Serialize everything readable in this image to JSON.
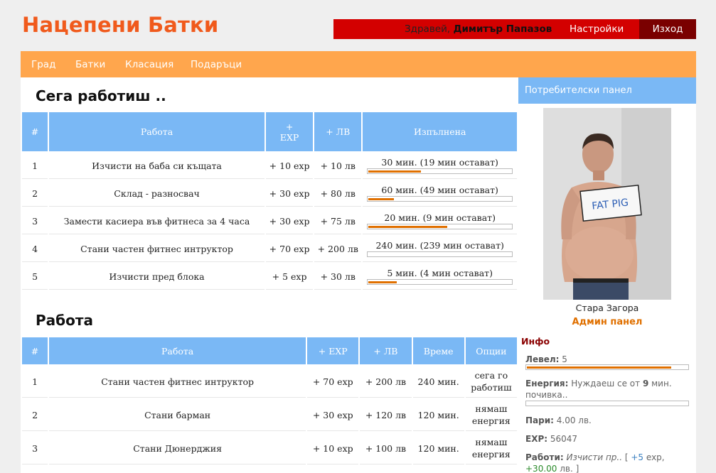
{
  "header": {
    "logo": "Нацепени Батки",
    "greeting": "Здравей, ",
    "username": "Димитър Папазов",
    "settings": "Настройки",
    "logout": "Изход"
  },
  "nav": [
    "Град",
    "Батки",
    "Класация",
    "Подаръци"
  ],
  "current": {
    "title": "Сега работиш ..",
    "headers": [
      "#",
      "Работа",
      "+ EXP",
      "+ ЛВ",
      "Изпълнена"
    ],
    "rows": [
      {
        "n": "1",
        "job": "Изчисти на баба си къщата",
        "exp": "+ 10 exp",
        "lv": "+ 10 лв",
        "status": "30 мин. (19 мин остават)",
        "progress": 0.37
      },
      {
        "n": "2",
        "job": "Склад - разносвач",
        "exp": "+ 30 exp",
        "lv": "+ 80 лв",
        "status": "60 мин. (49 мин остават)",
        "progress": 0.18
      },
      {
        "n": "3",
        "job": "Замести касиера във фитнеса за 4 часа",
        "exp": "+ 30 exp",
        "lv": "+ 75 лв",
        "status": "20 мин. (9 мин остават)",
        "progress": 0.55
      },
      {
        "n": "4",
        "job": "Стани частен фитнес интруктор",
        "exp": "+ 70 exp",
        "lv": "+ 200 лв",
        "status": "240 мин. (239 мин остават)",
        "progress": 0.0
      },
      {
        "n": "5",
        "job": "Изчисти пред блока",
        "exp": "+ 5 exp",
        "lv": "+ 30 лв",
        "status": "5 мин. (4 мин остават)",
        "progress": 0.2
      }
    ]
  },
  "work": {
    "title": "Работа",
    "headers": [
      "#",
      "Работа",
      "+ EXP",
      "+ ЛВ",
      "Време",
      "Опции"
    ],
    "rows": [
      {
        "n": "1",
        "job": "Стани частен фитнес интруктор",
        "exp": "+ 70 exp",
        "lv": "+ 200 лв",
        "time": "240 мин.",
        "option": "сега го работиш"
      },
      {
        "n": "2",
        "job": "Стани барман",
        "exp": "+ 30 exp",
        "lv": "+ 120 лв",
        "time": "120 мин.",
        "option": "нямаш енергия"
      },
      {
        "n": "3",
        "job": "Стани Дюнерджия",
        "exp": "+ 10 exp",
        "lv": "+ 100 лв",
        "time": "120 мин.",
        "option": "нямаш енергия"
      }
    ]
  },
  "sidebar": {
    "title": "Потребителски панел",
    "photo_sign": "FAT PIG",
    "city": "Стара Загора",
    "admin": "Админ панел",
    "info_title": "Инфо",
    "level_label": "Левел:",
    "level_value": "5",
    "level_progress": 0.9,
    "energy_label": "Енергия:",
    "energy_text_a": "Нуждаеш се от ",
    "energy_minutes": "9",
    "energy_text_b": " мин. почивка..",
    "energy_progress": 0.0,
    "money_label": "Пари:",
    "money_value": "4.00 лв.",
    "exp_label": "EXP:",
    "exp_value": "56047",
    "jobs_label": "Работи:",
    "jobs_job": "Изчисти пр..",
    "jobs_open": " [ ",
    "jobs_exp": "+5",
    "jobs_exp_unit": " exp, ",
    "jobs_money": "+30.00",
    "jobs_money_unit": " лв. ]"
  },
  "colors": {
    "logo": "#f05a1c",
    "userbar": "#d30000",
    "logout_bg": "#7a0000",
    "nav": "#ffa64d",
    "table_header": "#7ab8f5",
    "progress": "#e07000"
  }
}
